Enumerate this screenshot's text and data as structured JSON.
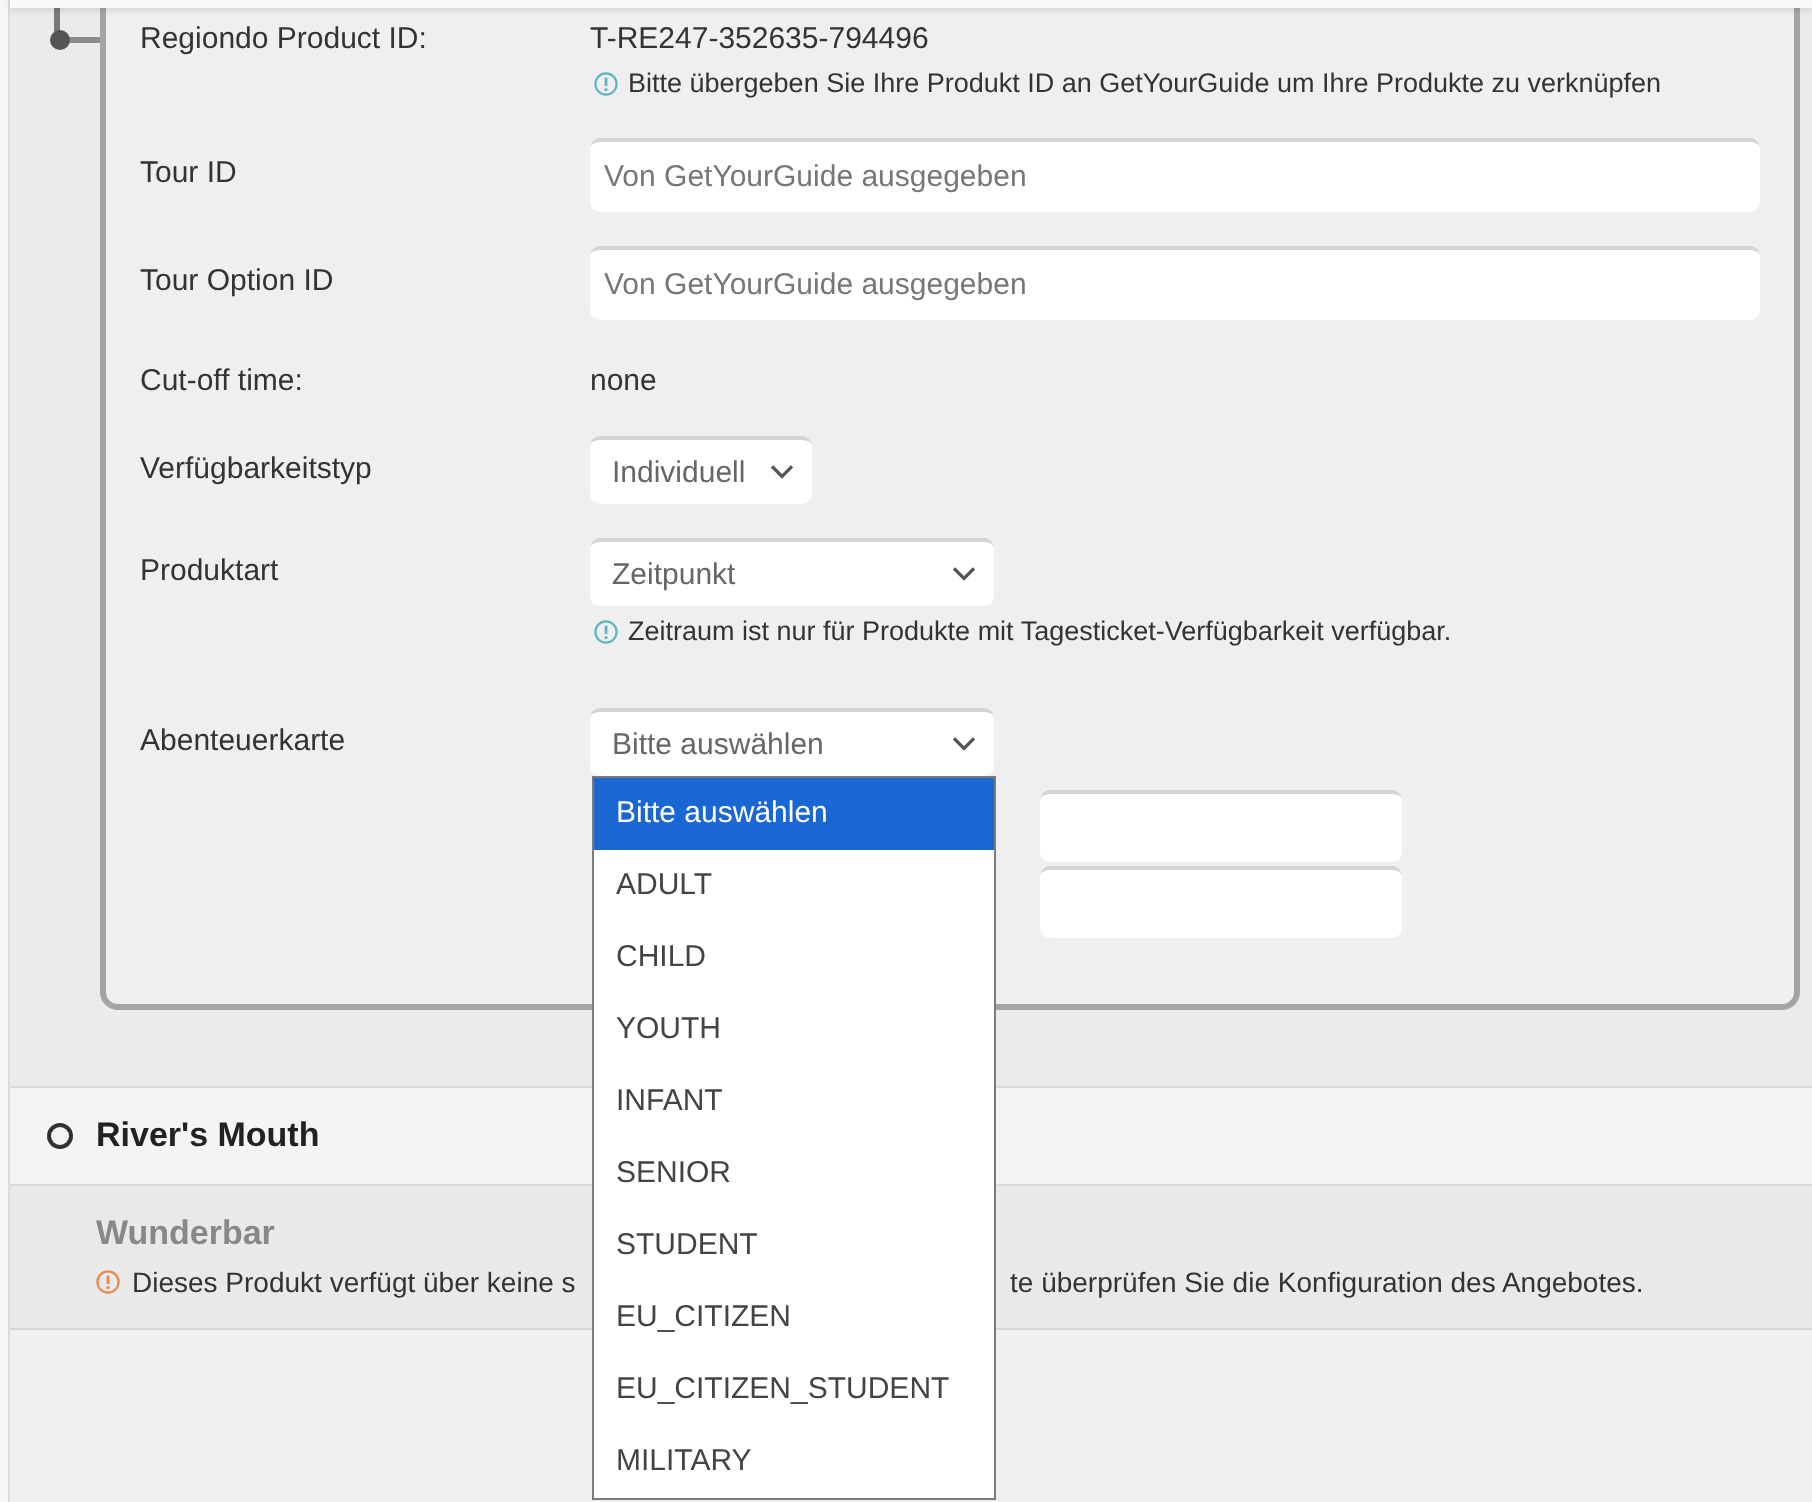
{
  "product_section": {
    "fields": [
      {
        "kind": "text",
        "label": "Regiondo Product ID:",
        "value": "T-RE247-352635-794496",
        "hint": "Bitte übergeben Sie Ihre Produkt ID an GetYourGuide um Ihre Produkte zu verknüpfen"
      },
      {
        "kind": "input",
        "label": "Tour ID",
        "placeholder": "Von GetYourGuide ausgegeben"
      },
      {
        "kind": "input",
        "label": "Tour Option ID",
        "placeholder": "Von GetYourGuide ausgegeben"
      },
      {
        "kind": "text",
        "label": "Cut-off time:",
        "value": "none"
      },
      {
        "kind": "select",
        "label": "Verfügbarkeitstyp",
        "value": "Individuell"
      },
      {
        "kind": "select",
        "label": "Produktart",
        "value": "Zeitpunkt",
        "hint": "Zeitraum ist nur für Produkte mit Tagesticket-Verfügbarkeit verfügbar."
      },
      {
        "kind": "select",
        "label": "Abenteuerkarte",
        "value": "Bitte auswählen",
        "expanded": true,
        "options": [
          {
            "label": "Bitte auswählen",
            "selected": true
          },
          {
            "label": "ADULT",
            "selected": false
          },
          {
            "label": "CHILD",
            "selected": false
          },
          {
            "label": "YOUTH",
            "selected": false
          },
          {
            "label": "INFANT",
            "selected": false
          },
          {
            "label": "SENIOR",
            "selected": false
          },
          {
            "label": "STUDENT",
            "selected": false
          },
          {
            "label": "EU_CITIZEN",
            "selected": false
          },
          {
            "label": "EU_CITIZEN_STUDENT",
            "selected": false
          },
          {
            "label": "MILITARY",
            "selected": false
          }
        ]
      }
    ],
    "extra_fields": [
      {
        "kind": "input"
      },
      {
        "kind": "input"
      }
    ]
  },
  "options": [
    {
      "title": "River's Mouth",
      "selected": false,
      "offer": {
        "title": "Wunderbar",
        "warning_parts": [
          "Dieses Produkt verfügt über keine s",
          "te überprüfen Sie die Konfiguration des Angebotes."
        ]
      }
    }
  ]
}
